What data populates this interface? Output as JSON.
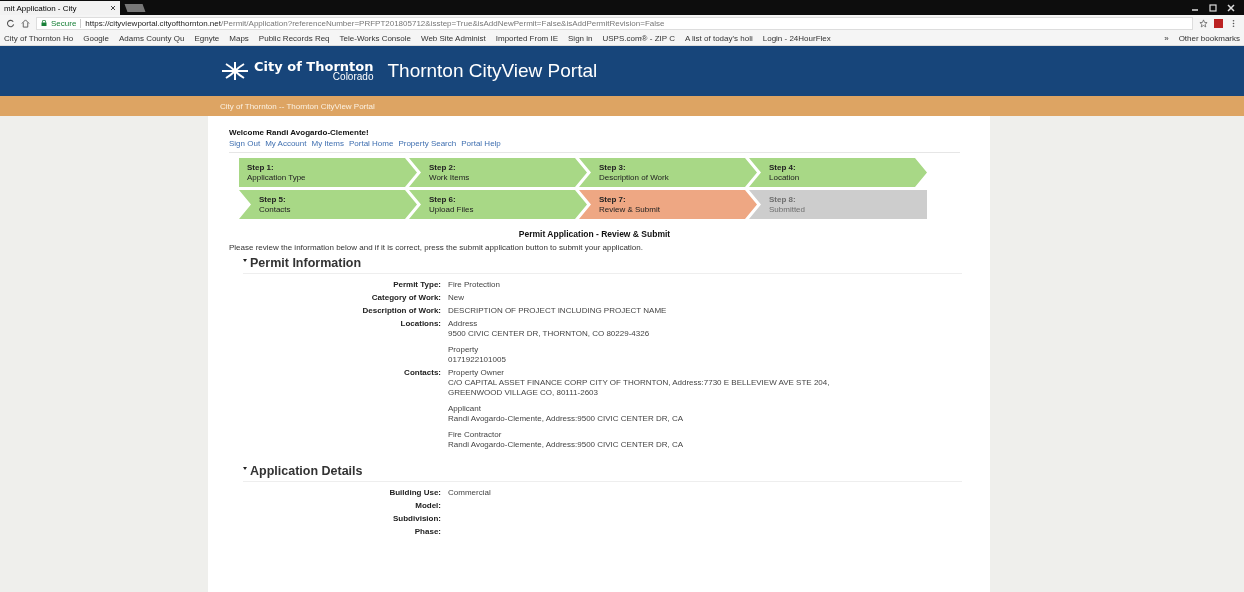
{
  "browser": {
    "tab_title": "mit Application - City",
    "url_host": "https://cityviewportal.cityofthornton.net",
    "url_path": "/Permit/Application?referenceNumber=PRFPT201805712&isstep=True&isAddNewPermit=False&isAddPermitRevision=False",
    "secure_label": "Secure",
    "bookmarks": [
      "City of Thornton Ho",
      "Google",
      "Adams County Qu",
      "Egnyte",
      "Maps",
      "Public Records Req",
      "Tele-Works Console",
      "Web Site Administ",
      "Imported From IE",
      "Sign in",
      "USPS.com® - ZIP C",
      "A list of today's holi",
      "Login - 24HourFlex"
    ],
    "more": "»",
    "other_bookmarks": "Other bookmarks"
  },
  "header": {
    "logo_line1": "City of Thornton",
    "logo_line2": "Colorado",
    "title": "Thornton CityView Portal",
    "breadcrumb": "City of Thornton -- Thornton CityView Portal"
  },
  "welcome": "Welcome Randi Avogardo-Clemente!",
  "nav_links": [
    "Sign Out",
    "My Account",
    "My Items",
    "Portal Home",
    "Property Search",
    "Portal Help"
  ],
  "steps": [
    [
      {
        "label": "Step 1:",
        "name": "Application Type",
        "completed": true,
        "selected": false
      },
      {
        "label": "Step 2:",
        "name": "Work Items",
        "completed": true,
        "selected": false
      },
      {
        "label": "Step 3:",
        "name": "Description of Work",
        "completed": true,
        "selected": false
      },
      {
        "label": "Step 4:",
        "name": "Location",
        "completed": true,
        "selected": false
      }
    ],
    [
      {
        "label": "Step 5:",
        "name": "Contacts",
        "completed": true,
        "selected": false
      },
      {
        "label": "Step 6:",
        "name": "Upload Files",
        "completed": true,
        "selected": false
      },
      {
        "label": "Step 7:",
        "name": "Review & Submit",
        "completed": false,
        "selected": true
      },
      {
        "label": "Step 8:",
        "name": "Submitted",
        "completed": false,
        "selected": false
      }
    ]
  ],
  "page_title": "Permit Application - Review & Submit",
  "instructions": "Please review the information below and if it is correct, press the submit application button to submit your application.",
  "sections": [
    {
      "title": "Permit Information",
      "expanded": true,
      "fields": [
        {
          "label": "Permit Type:",
          "lines": [
            [
              "Fire Protection"
            ]
          ]
        },
        {
          "label": "Category of Work:",
          "lines": [
            [
              "New"
            ]
          ]
        },
        {
          "label": "Description of Work:",
          "lines": [
            [
              "DESCRIPTION OF PROJECT INCLUDING PROJECT NAME"
            ]
          ]
        },
        {
          "label": "Locations:",
          "lines": [
            [
              "Address",
              "9500 CIVIC CENTER DR, THORNTON, CO 80229-4326"
            ],
            [
              "Property",
              "0171922101005"
            ]
          ]
        },
        {
          "label": "Contacts:",
          "lines": [
            [
              "Property Owner",
              "C/O CAPITAL ASSET FINANCE CORP CITY OF THORNTON, Address:7730 E BELLEVIEW AVE STE 204,",
              "GREENWOOD VILLAGE CO, 80111-2603"
            ],
            [
              "Applicant",
              "Randi Avogardo-Clemente, Address:9500 CIVIC CENTER DR, CA"
            ],
            [
              "Fire Contractor",
              "Randi Avogardo-Clemente, Address:9500 CIVIC CENTER DR, CA"
            ]
          ]
        }
      ]
    },
    {
      "title": "Application Details",
      "expanded": true,
      "fields": [
        {
          "label": "Building Use:",
          "lines": [
            [
              "Commercial"
            ]
          ]
        },
        {
          "label": "Model:"
        },
        {
          "label": "Subdivision:"
        },
        {
          "label": "Phase:"
        }
      ]
    }
  ]
}
